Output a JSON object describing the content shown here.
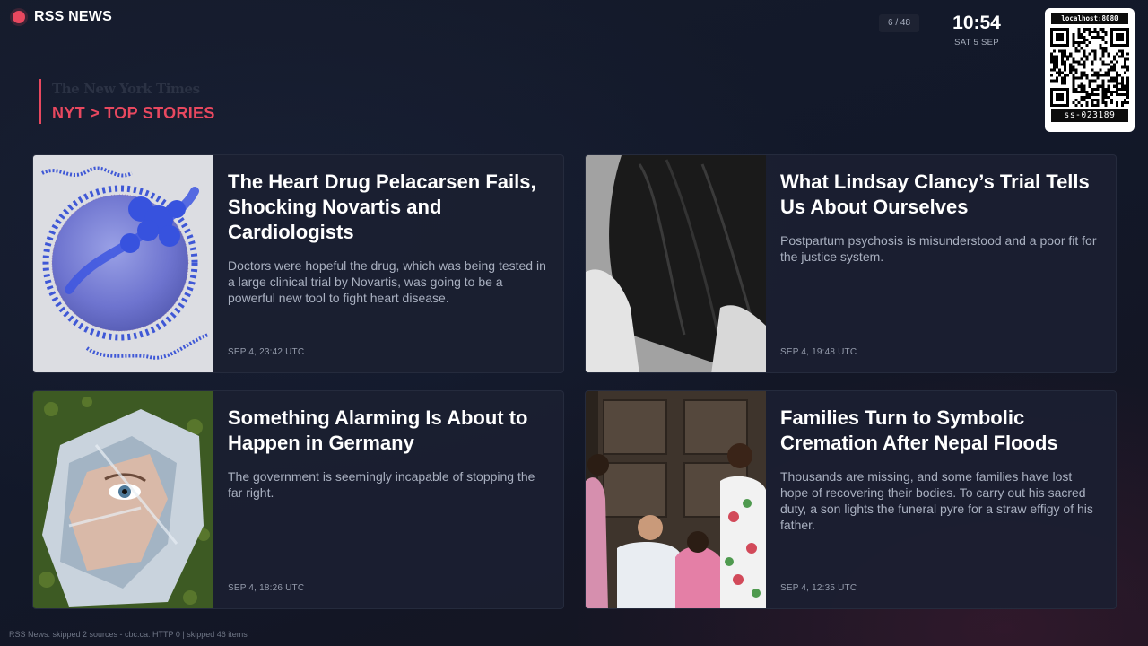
{
  "app": {
    "brand": "RSS NEWS"
  },
  "header": {
    "page_counter": "6 / 48",
    "time": "10:54",
    "date": "SAT 5 SEP"
  },
  "qr": {
    "host": "localhost:8080",
    "id": "ss-023189"
  },
  "source": {
    "logo_text": "The New York Times",
    "title": "NYT > TOP STORIES"
  },
  "articles": [
    {
      "title": "The Heart Drug Pelacarsen Fails, Shocking Novartis and Cardiologists",
      "summary": "Doctors were hopeful the drug, which was being tested in a large clinical trial by Novartis, was going to be a powerful new tool to fight heart disease.",
      "date": "SEP 4, 23:42 UTC",
      "image": "lipoprotein-particle-illustration"
    },
    {
      "title": "What Lindsay Clancy’s Trial Tells Us About Ourselves",
      "summary": "Postpartum psychosis is misunderstood and a poor fit for the justice system.",
      "date": "SEP 4, 19:48 UTC",
      "image": "woman-hair-photo"
    },
    {
      "title": "Something Alarming Is About to Happen in Germany",
      "summary": "The government is seemingly incapable of stopping the far right.",
      "date": "SEP 4, 18:26 UTC",
      "image": "crumpled-face-poster-photo"
    },
    {
      "title": "Families Turn to Symbolic Cremation After Nepal Floods",
      "summary": "Thousands are missing, and some families have lost hope of recovering their bodies. To carry out his sacred duty, a son lights the funeral pyre for a straw effigy of his father.",
      "date": "SEP 4, 12:35 UTC",
      "image": "nepal-family-photo"
    }
  ],
  "footer": {
    "status": "RSS News: skipped 2 sources - cbc.ca: HTTP 0 | skipped 46 items"
  },
  "colors": {
    "accent": "#e8485f",
    "background": "#131a2a",
    "card": "#1b2031"
  }
}
